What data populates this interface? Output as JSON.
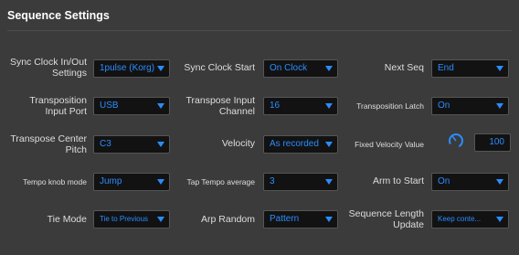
{
  "title": "Sequence Settings",
  "accent": "#2a8dff",
  "rows": [
    {
      "col1": {
        "label": "Sync Clock In/Out\nSettings",
        "value": "1pulse (Korg)"
      },
      "col2": {
        "label": "Sync Clock Start",
        "value": "On Clock"
      },
      "col3": {
        "label": "Next Seq",
        "value": "End"
      }
    },
    {
      "col1": {
        "label": "Transposition\nInput Port",
        "value": "USB"
      },
      "col2": {
        "label": "Transpose Input\nChannel",
        "value": "16"
      },
      "col3": {
        "label": "Transposition Latch",
        "value": "On"
      }
    },
    {
      "col1": {
        "label": "Transpose Center\nPitch",
        "value": "C3"
      },
      "col2": {
        "label": "Velocity",
        "value": "As recorded"
      },
      "col3": {
        "label": "Fixed Velocity Value",
        "value": "100",
        "knob_icon": "knob-icon"
      }
    },
    {
      "col1": {
        "label": "Tempo knob mode",
        "value": "Jump"
      },
      "col2": {
        "label": "Tap Tempo average",
        "value": "3"
      },
      "col3": {
        "label": "Arm to Start",
        "value": "On"
      }
    },
    {
      "col1": {
        "label": "Tie Mode",
        "value": "Tie to Previous"
      },
      "col2": {
        "label": "Arp Random",
        "value": "Pattern"
      },
      "col3": {
        "label": "Sequence Length\nUpdate",
        "value": "Keep conte..."
      }
    }
  ]
}
